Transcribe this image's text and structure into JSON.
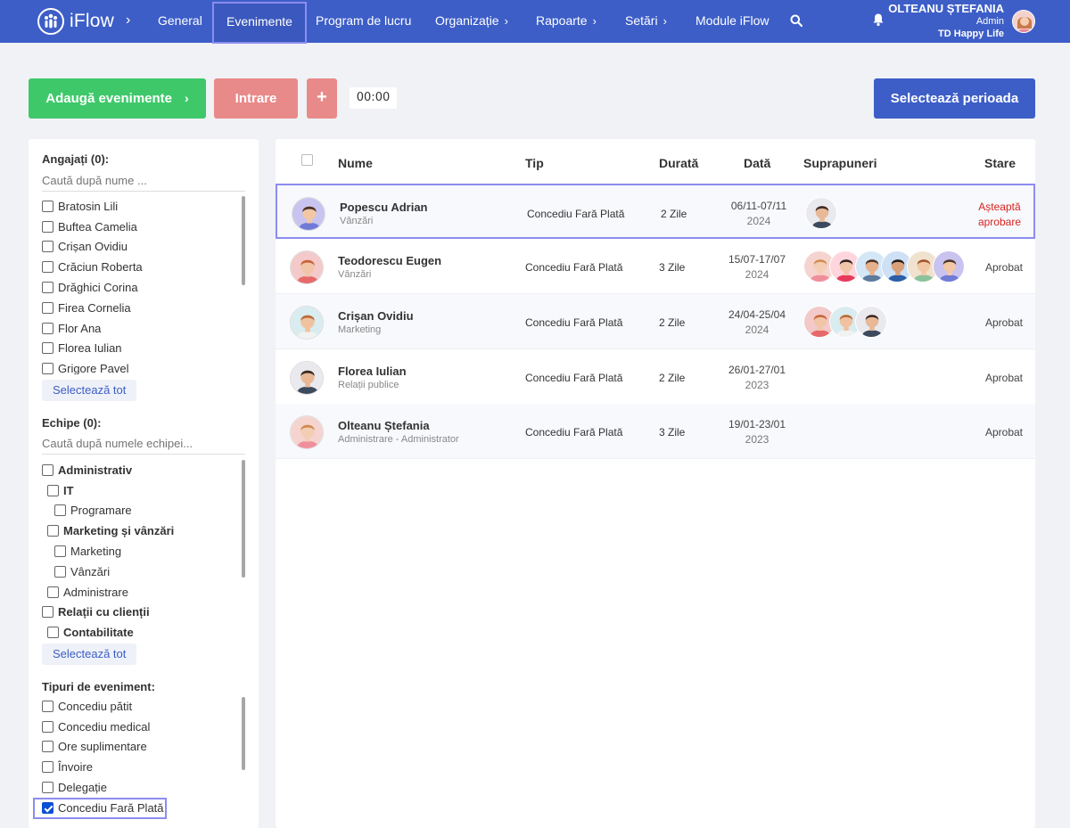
{
  "nav": {
    "logo_text": "iFlow",
    "items": [
      {
        "label": "General",
        "caret": ""
      },
      {
        "label": "Evenimente",
        "caret": ""
      },
      {
        "label": "Program de lucru",
        "caret": ""
      },
      {
        "label": "Organizație",
        "caret": "›"
      },
      {
        "label": "Rapoarte",
        "caret": "›"
      },
      {
        "label": "Setări",
        "caret": "›"
      },
      {
        "label": "Module iFlow",
        "caret": ""
      }
    ],
    "active": "Evenimente",
    "user": {
      "name": "OLTEANU ȘTEFANIA",
      "role": "Admin",
      "company": "TD Happy Life"
    },
    "brand_color": "#3d5ec7"
  },
  "toolbar": {
    "add_events_label": "Adaugă evenimente",
    "add_events_caret": "›",
    "entry_label": "Intrare",
    "plus_label": "+",
    "timer_value": "00:00",
    "select_period_label": "Selectează perioada"
  },
  "sidebar": {
    "employees": {
      "title": "Angajați (0):",
      "search_placeholder": "Caută după nume ...",
      "items": [
        "Bratosin Lili",
        "Buftea Camelia",
        "Crișan Ovidiu",
        "Crăciun Roberta",
        "Drăghici Corina",
        "Firea Cornelia",
        "Flor Ana",
        "Florea Iulian",
        "Grigore Pavel"
      ],
      "select_all": "Selectează tot"
    },
    "teams": {
      "title": "Echipe (0):",
      "search_placeholder": "Caută după numele echipei...",
      "items": [
        {
          "label": "Administrativ",
          "bold": true,
          "indent": 0
        },
        {
          "label": "IT",
          "bold": true,
          "indent": 1
        },
        {
          "label": "Programare",
          "bold": false,
          "indent": 2
        },
        {
          "label": "Marketing și vânzări",
          "bold": true,
          "indent": 1
        },
        {
          "label": "Marketing",
          "bold": false,
          "indent": 2
        },
        {
          "label": "Vânzări",
          "bold": false,
          "indent": 2
        },
        {
          "label": "Administrare",
          "bold": false,
          "indent": 1
        },
        {
          "label": "Relații cu clienții",
          "bold": true,
          "indent": 0
        },
        {
          "label": "Contabilitate",
          "bold": true,
          "indent": 1
        }
      ],
      "select_all": "Selectează tot"
    },
    "event_types": {
      "title": "Tipuri de eveniment:",
      "items": [
        {
          "label": "Concediu pătit",
          "checked": false
        },
        {
          "label": "Concediu medical",
          "checked": false
        },
        {
          "label": "Ore suplimentare",
          "checked": false
        },
        {
          "label": "Învoire",
          "checked": false
        },
        {
          "label": "Delegație",
          "checked": false
        },
        {
          "label": "Concediu Fară Plată",
          "checked": true
        }
      ]
    }
  },
  "table": {
    "headers": {
      "name": "Nume",
      "type": "Tip",
      "duration": "Durată",
      "date": "Dată",
      "overlaps": "Suprapuneri",
      "status": "Stare"
    },
    "rows": [
      {
        "name": "Popescu Adrian",
        "dept": "Vânzări",
        "type": "Concediu Fară Plată",
        "duration": "2 Zile",
        "date": "06/11-07/11",
        "year": "2024",
        "overlaps": 1,
        "status": "Așteaptă aprobare",
        "status_line1": "Așteaptă",
        "status_line2": "aprobare",
        "pending": true,
        "selected": true
      },
      {
        "name": "Teodorescu Eugen",
        "dept": "Vânzări",
        "type": "Concediu Fară Plată",
        "duration": "3 Zile",
        "date": "15/07-17/07",
        "year": "2024",
        "overlaps": 6,
        "status": "Aprobat",
        "pending": false
      },
      {
        "name": "Crișan Ovidiu",
        "dept": "Marketing",
        "type": "Concediu Fară Plată",
        "duration": "2 Zile",
        "date": "24/04-25/04",
        "year": "2024",
        "overlaps": 3,
        "status": "Aprobat",
        "pending": false
      },
      {
        "name": "Florea Iulian",
        "dept": "Relații publice",
        "type": "Concediu Fară Plată",
        "duration": "2 Zile",
        "date": "26/01-27/01",
        "year": "2023",
        "overlaps": 0,
        "status": "Aprobat",
        "pending": false
      },
      {
        "name": "Olteanu Ștefania",
        "dept": "Administrare - Administrator",
        "type": "Concediu Fară Plată",
        "duration": "3 Zile",
        "date": "19/01-23/01",
        "year": "2023",
        "overlaps": 0,
        "status": "Aprobat",
        "pending": false
      }
    ]
  }
}
